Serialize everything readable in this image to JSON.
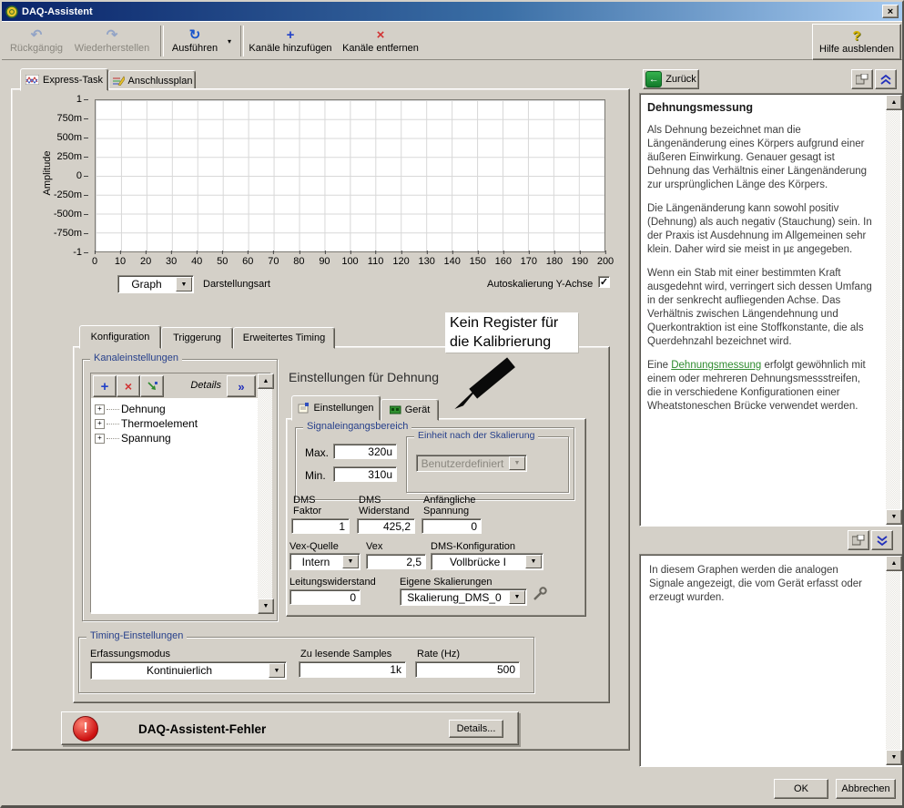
{
  "window": {
    "title": "DAQ-Assistent"
  },
  "titlebar": {
    "close": "×"
  },
  "toolbar": {
    "undo": "Rückgängig",
    "redo": "Wiederherstellen",
    "run": "Ausführen",
    "add_channels": "Kanäle hinzufügen",
    "remove_channels": "Kanäle entfernen",
    "hide_help": "Hilfe ausblenden"
  },
  "icons": {
    "undo": "↶",
    "redo": "↷",
    "run": "↻",
    "plus": "+",
    "cross": "×",
    "help": "?",
    "dropdown": "▼",
    "up": "▲",
    "down": "▼",
    "check": "✓",
    "details_chevrons": "»",
    "back": "←",
    "exclaim": "!",
    "tree_expand": "+",
    "run_menu": "▾"
  },
  "main_tabs": {
    "express": "Express-Task",
    "connection": "Anschlussplan"
  },
  "graph": {
    "ylabel": "Amplitude",
    "y_ticks": [
      "1",
      "750m",
      "500m",
      "250m",
      "0",
      "-250m",
      "-500m",
      "-750m",
      "-1"
    ],
    "x_ticks": [
      "0",
      "10",
      "20",
      "30",
      "40",
      "50",
      "60",
      "70",
      "80",
      "90",
      "100",
      "110",
      "120",
      "130",
      "140",
      "150",
      "160",
      "170",
      "180",
      "190",
      "200"
    ],
    "display_type_value": "Graph",
    "display_type_label": "Darstellungsart",
    "autoscale_label": "Autoskalierung Y-Achse",
    "autoscale_checked": true
  },
  "config": {
    "tab_configuration": "Konfiguration",
    "tab_triggering": "Triggerung",
    "tab_advanced_timing": "Erweitertes Timing",
    "channel_settings": {
      "legend": "Kanaleinstellungen",
      "details_label": "Details",
      "channels": [
        "Dehnung",
        "Thermoelement",
        "Spannung"
      ]
    },
    "settings": {
      "heading": "Einstellungen für Dehnung",
      "tab_settings": "Einstellungen",
      "tab_device": "Gerät",
      "signal_range_legend": "Signaleingangsbereich",
      "max_label": "Max.",
      "max_value": "320u",
      "min_label": "Min.",
      "min_value": "310u",
      "unit_legend": "Einheit nach der Skalierung",
      "unit_value": "Benutzerdefiniert",
      "gage_factor_label": "DMS Faktor",
      "gage_factor_value": "1",
      "gage_resistance_label": "DMS Widerstand",
      "gage_resistance_value": "425,2",
      "initial_voltage_label": "Anfängliche Spannung",
      "initial_voltage_value": "0",
      "vex_source_label": "Vex-Quelle",
      "vex_source_value": "Intern",
      "vex_label": "Vex",
      "vex_value": "2,5",
      "dms_config_label": "DMS-Konfiguration",
      "dms_config_value": "Vollbrücke I",
      "lead_resistance_label": "Leitungswiderstand",
      "lead_resistance_value": "0",
      "custom_scaling_label": "Eigene Skalierungen",
      "custom_scaling_value": "Skalierung_DMS_0"
    },
    "timing": {
      "legend": "Timing-Einstellungen",
      "mode_label": "Erfassungsmodus",
      "mode_value": "Kontinuierlich",
      "samples_label": "Zu lesende Samples",
      "samples_value": "1k",
      "rate_label": "Rate (Hz)",
      "rate_value": "500"
    },
    "error": {
      "text": "DAQ-Assistent-Fehler",
      "details": "Details..."
    }
  },
  "help": {
    "back": "Zurück",
    "title": "Dehnungsmessung",
    "paragraphs": [
      "Als Dehnung bezeichnet man die Längenänderung eines Körpers aufgrund einer äußeren Einwirkung. Genauer gesagt ist Dehnung das Verhältnis einer Längenänderung zur ursprünglichen Länge des Körpers.",
      "Die Längenänderung kann sowohl positiv (Dehnung) als auch negativ (Stauchung) sein. In der Praxis ist Ausdehnung im Allgemeinen sehr klein. Daher wird sie meist in µε angegeben.",
      "Wenn ein Stab mit einer bestimmten Kraft ausgedehnt wird, verringert sich dessen Umfang in der senkrecht aufliegenden Achse. Das Verhältnis zwischen Längendehnung und Querkontraktion ist eine Stoffkonstante, die als Querdehnzahl bezeichnet wird."
    ],
    "link_paragraph": {
      "pre": "Eine ",
      "link": "Dehnungsmessung",
      "post": " erfolgt gewöhnlich mit einem oder mehreren Dehnungsmessstreifen, die in verschiedene Konfigurationen einer Wheatstoneschen Brücke verwendet werden."
    },
    "graph_info": "In diesem Graphen werden die analogen Signale angezeigt, die vom Gerät erfasst oder erzeugt wurden."
  },
  "annotation": {
    "line1": "Kein Register für",
    "line2": "die Kalibrierung"
  },
  "footer": {
    "ok": "OK",
    "cancel": "Abbrechen"
  },
  "colors": {
    "titlebar_start": "#0a246a",
    "titlebar_end": "#a6caf0",
    "accent_blue": "#2242c8",
    "error_red": "#cc1111",
    "link_green": "#2e8b2e",
    "legend_blue": "#27408b",
    "window_gray": "#d4d0c8"
  }
}
